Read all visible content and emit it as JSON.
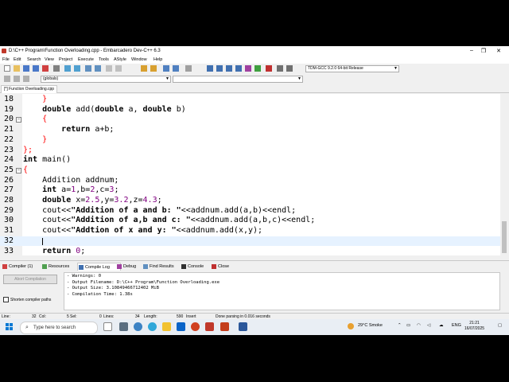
{
  "window": {
    "title": "D:\\C++ Program\\Function Overloading.cpp - Embarcadero Dev-C++ 6.3",
    "minimize": "–",
    "maximize": "❐",
    "close": "✕"
  },
  "menu": [
    "File",
    "Edit",
    "Search",
    "View",
    "Project",
    "Execute",
    "Tools",
    "AStyle",
    "Window",
    "Help"
  ],
  "toolbar": {
    "compiler": "TDM-GCC 9.2.0 64-bit Release",
    "scope": "(globals)",
    "member": ""
  },
  "file_tab": "[*] Function Overloading.cpp",
  "editor": {
    "lines": [
      {
        "n": "18",
        "fold": "",
        "code": [
          {
            "t": "    }",
            "c": "sym"
          }
        ]
      },
      {
        "n": "19",
        "fold": "",
        "code": [
          {
            "t": "    ",
            "c": ""
          },
          {
            "t": "double",
            "c": "kw"
          },
          {
            "t": " add(",
            "c": ""
          },
          {
            "t": "double",
            "c": "kw"
          },
          {
            "t": " a, ",
            "c": ""
          },
          {
            "t": "double",
            "c": "kw"
          },
          {
            "t": " b)",
            "c": ""
          }
        ]
      },
      {
        "n": "20",
        "fold": "–",
        "code": [
          {
            "t": "    {",
            "c": "sym"
          }
        ]
      },
      {
        "n": "21",
        "fold": "",
        "code": [
          {
            "t": "        ",
            "c": ""
          },
          {
            "t": "return",
            "c": "kw"
          },
          {
            "t": " a+b;",
            "c": ""
          }
        ]
      },
      {
        "n": "22",
        "fold": "",
        "code": [
          {
            "t": "    }",
            "c": "sym"
          }
        ]
      },
      {
        "n": "23",
        "fold": "",
        "code": [
          {
            "t": "};",
            "c": "sym"
          }
        ]
      },
      {
        "n": "24",
        "fold": "",
        "code": [
          {
            "t": "int",
            "c": "kw"
          },
          {
            "t": " main()",
            "c": ""
          }
        ]
      },
      {
        "n": "25",
        "fold": "–",
        "code": [
          {
            "t": "{",
            "c": "sym"
          }
        ]
      },
      {
        "n": "26",
        "fold": "",
        "code": [
          {
            "t": "    Addition addnum;",
            "c": ""
          }
        ]
      },
      {
        "n": "27",
        "fold": "",
        "code": [
          {
            "t": "    ",
            "c": ""
          },
          {
            "t": "int",
            "c": "kw"
          },
          {
            "t": " a=",
            "c": ""
          },
          {
            "t": "1",
            "c": "num"
          },
          {
            "t": ",b=",
            "c": ""
          },
          {
            "t": "2",
            "c": "num"
          },
          {
            "t": ",c=",
            "c": ""
          },
          {
            "t": "3",
            "c": "num"
          },
          {
            "t": ";",
            "c": ""
          }
        ]
      },
      {
        "n": "28",
        "fold": "",
        "code": [
          {
            "t": "    ",
            "c": ""
          },
          {
            "t": "double",
            "c": "kw"
          },
          {
            "t": " x=",
            "c": ""
          },
          {
            "t": "2.5",
            "c": "num"
          },
          {
            "t": ",y=",
            "c": ""
          },
          {
            "t": "3.2",
            "c": "num"
          },
          {
            "t": ",z=",
            "c": ""
          },
          {
            "t": "4.3",
            "c": "num"
          },
          {
            "t": ";",
            "c": ""
          }
        ]
      },
      {
        "n": "29",
        "fold": "",
        "code": [
          {
            "t": "    cout<<",
            "c": ""
          },
          {
            "t": "\"Addition of a and b: \"",
            "c": "kw"
          },
          {
            "t": "<<addnum.add(a,b)<<endl;",
            "c": ""
          }
        ]
      },
      {
        "n": "30",
        "fold": "",
        "code": [
          {
            "t": "    cout<<",
            "c": ""
          },
          {
            "t": "\"Addition of a,b and c: \"",
            "c": "kw"
          },
          {
            "t": "<<addnum.add(a,b,c)<<endl;",
            "c": ""
          }
        ]
      },
      {
        "n": "31",
        "fold": "",
        "code": [
          {
            "t": "    cout<<",
            "c": ""
          },
          {
            "t": "\"Addtion of x and y: \"",
            "c": "kw"
          },
          {
            "t": "<<addnum.add(x,y);",
            "c": ""
          }
        ]
      },
      {
        "n": "32",
        "fold": "",
        "code": [
          {
            "t": "    ",
            "c": ""
          }
        ]
      },
      {
        "n": "33",
        "fold": "",
        "code": [
          {
            "t": "    ",
            "c": ""
          },
          {
            "t": "return",
            "c": "kw"
          },
          {
            "t": " ",
            "c": ""
          },
          {
            "t": "0",
            "c": "num"
          },
          {
            "t": ";",
            "c": ""
          }
        ]
      }
    ],
    "current_line": "32"
  },
  "bottom_tabs": [
    "Compiler (1)",
    "Resources",
    "Compile Log",
    "Debug",
    "Find Results",
    "Console",
    "Close"
  ],
  "active_bottom_tab": "Compile Log",
  "abort_label": "Abort Compilation",
  "shorten_label": "Shorten compiler paths",
  "log_lines": [
    "- Warnings: 0",
    "- Output Filename: D:\\C++ Program\\Function Overloading.exe",
    "- Output Size: 3.10849466712402 MiB",
    "- Compilation Time: 1.38s"
  ],
  "status": {
    "line": "Line:",
    "line_val": "32",
    "col": "Col:",
    "col_val": "5",
    "sel": "Sel:",
    "sel_val": "0",
    "lines": "Lines:",
    "lines_val": "34",
    "length": "Length:",
    "length_val": "590",
    "mode": "Insert",
    "parse": "Done parsing in 0.016 seconds"
  },
  "taskbar": {
    "search_placeholder": "Type here to search",
    "weather": "29°C  Smoke",
    "lang": "ENG",
    "time": "21:21",
    "date": "16/07/2025"
  }
}
